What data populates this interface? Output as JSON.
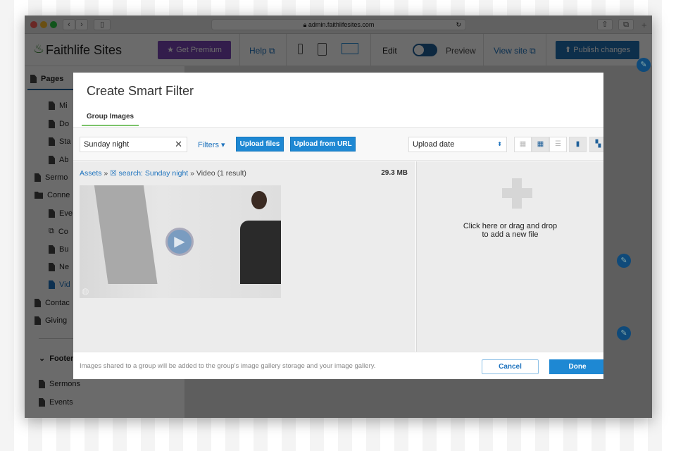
{
  "browser": {
    "url": "admin.faithlifesites.com"
  },
  "appbar": {
    "logo": "Faithlife Sites",
    "premium": "Get Premium",
    "help": "Help",
    "edit": "Edit",
    "preview": "Preview",
    "view_site": "View site",
    "publish": "Publish changes"
  },
  "sidebar": {
    "header": "Pages",
    "items": [
      "Mi",
      "Do",
      "Sta",
      "Ab",
      "Sermo",
      "Conne",
      "Eve",
      "Co",
      "Bu",
      "Ne",
      "Vid",
      "Contac",
      "Giving"
    ],
    "footer": "Footer",
    "footer_items": [
      "Sermons",
      "Events"
    ]
  },
  "modal": {
    "title": "Create Smart Filter",
    "tab": "Group Images",
    "search_value": "Sunday night",
    "filters": "Filters",
    "upload_files": "Upload files",
    "upload_url": "Upload from URL",
    "sort": "Upload date",
    "breadcrumb": {
      "root": "Assets",
      "search": "search: Sunday night",
      "type": "Video",
      "count": "(1 result)"
    },
    "size": "29.3 MB",
    "drop_line1": "Click here or drag and drop",
    "drop_line2": "to add a new file",
    "footer_note": "Images shared to a group will be added to the group's image gallery storage and your image gallery.",
    "cancel": "Cancel",
    "done": "Done"
  },
  "colors": {
    "accent": "#1e88d3",
    "premium": "#4a2a6e",
    "tab_underline": "#7cc36a"
  }
}
